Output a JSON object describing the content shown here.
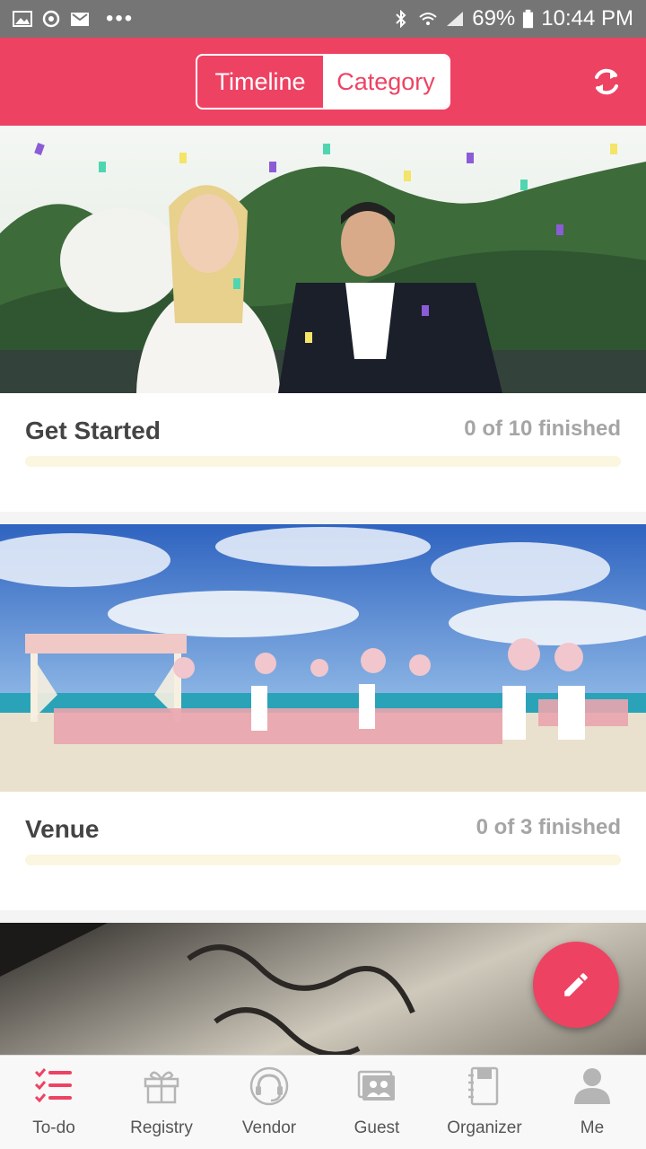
{
  "status_bar": {
    "dots": "•••",
    "battery": "69%",
    "time": "10:44 PM"
  },
  "header": {
    "segments": [
      {
        "label": "Timeline",
        "selected": false
      },
      {
        "label": "Category",
        "selected": true
      }
    ]
  },
  "cards": [
    {
      "title": "Get Started",
      "progress_text": "0 of 10 finished",
      "progress": 0
    },
    {
      "title": "Venue",
      "progress_text": "0 of 3 finished",
      "progress": 0
    },
    {
      "title": "",
      "progress_text": "",
      "progress": 0
    }
  ],
  "tabs": [
    {
      "label": "To-do",
      "icon": "todo-list-icon"
    },
    {
      "label": "Registry",
      "icon": "gift-icon"
    },
    {
      "label": "Vendor",
      "icon": "headset-icon"
    },
    {
      "label": "Guest",
      "icon": "guests-icon"
    },
    {
      "label": "Organizer",
      "icon": "notebook-icon"
    },
    {
      "label": "Me",
      "icon": "person-icon"
    }
  ],
  "colors": {
    "accent": "#ee4263",
    "status_bar": "#757575",
    "progress_track": "#fbf6df"
  }
}
